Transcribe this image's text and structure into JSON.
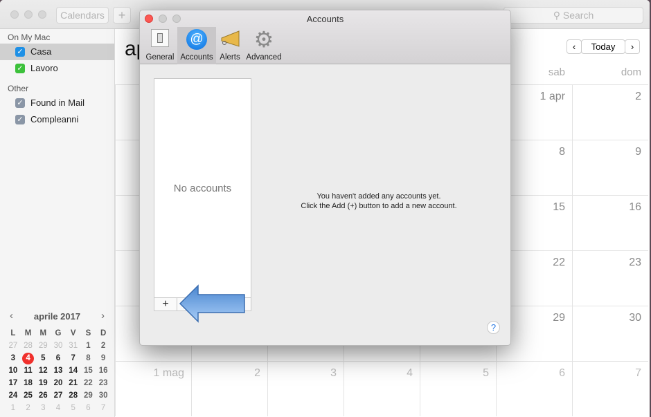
{
  "toolbar": {
    "calendars_label": "Calendars",
    "add_label": "+",
    "search_placeholder": "Search"
  },
  "sidebar": {
    "sections": [
      {
        "title": "On My Mac",
        "items": [
          {
            "label": "Casa",
            "checked": true,
            "color": "#1e90e6",
            "selected": true
          },
          {
            "label": "Lavoro",
            "checked": true,
            "color": "#3cc13b"
          }
        ]
      },
      {
        "title": "Other",
        "items": [
          {
            "label": "Found in Mail",
            "checked": true,
            "color": "#8a96a6"
          },
          {
            "label": "Compleanni",
            "checked": true,
            "color": "#8a96a6"
          }
        ]
      }
    ]
  },
  "mini_calendar": {
    "title": "aprile 2017",
    "prev": "‹",
    "next": "›",
    "weekdays": [
      "L",
      "M",
      "M",
      "G",
      "V",
      "S",
      "D"
    ],
    "today": "4",
    "weeks": [
      [
        "27",
        "28",
        "29",
        "30",
        "31",
        "1",
        "2"
      ],
      [
        "3",
        "4",
        "5",
        "6",
        "7",
        "8",
        "9"
      ],
      [
        "10",
        "11",
        "12",
        "13",
        "14",
        "15",
        "16"
      ],
      [
        "17",
        "18",
        "19",
        "20",
        "21",
        "22",
        "23"
      ],
      [
        "24",
        "25",
        "26",
        "27",
        "28",
        "29",
        "30"
      ],
      [
        "1",
        "2",
        "3",
        "4",
        "5",
        "6",
        "7"
      ]
    ]
  },
  "main": {
    "month_title": "ap",
    "prev": "‹",
    "today_label": "Today",
    "next": "›",
    "weekdays_visible": [
      "sab",
      "dom"
    ],
    "rows": [
      [
        null,
        null,
        null,
        null,
        null,
        "1 apr",
        "2"
      ],
      [
        null,
        null,
        null,
        null,
        null,
        "8",
        "9"
      ],
      [
        null,
        null,
        null,
        null,
        null,
        "15",
        "16"
      ],
      [
        null,
        null,
        null,
        null,
        null,
        "22",
        "23"
      ],
      [
        null,
        null,
        null,
        null,
        null,
        "29",
        "30"
      ],
      [
        "1 mag",
        "2",
        "3",
        "4",
        "5",
        "6",
        "7"
      ]
    ]
  },
  "dialog": {
    "title": "Accounts",
    "tabs": [
      {
        "label": "General",
        "icon": "switch-icon"
      },
      {
        "label": "Accounts",
        "icon": "at-sign-icon",
        "selected": true
      },
      {
        "label": "Alerts",
        "icon": "megaphone-icon"
      },
      {
        "label": "Advanced",
        "icon": "gear-icon"
      }
    ],
    "empty_list": "No accounts",
    "add_button": "+",
    "message_line1": "You haven't added any accounts yet.",
    "message_line2": "Click the Add (+) button to add a new account.",
    "help": "?",
    "arrow_color": "#4a86d0"
  }
}
